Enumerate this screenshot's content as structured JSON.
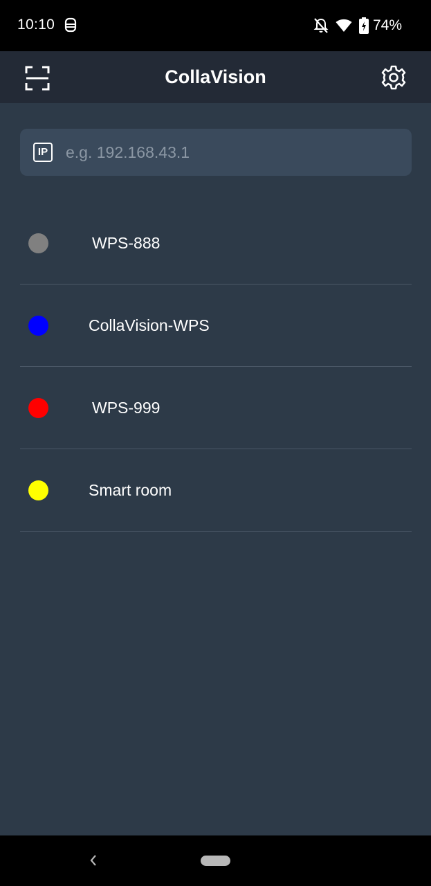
{
  "status_bar": {
    "time": "10:10",
    "battery": "74%",
    "icons": [
      "notification-icon",
      "bell-off-icon",
      "wifi-icon",
      "battery-charging-icon"
    ]
  },
  "app_bar": {
    "title": "CollaVision",
    "left_icon": "scan-icon",
    "right_icon": "gear-icon"
  },
  "ip_field": {
    "icon_label": "IP",
    "placeholder": "e.g. 192.168.43.1",
    "value": ""
  },
  "devices": [
    {
      "name": "WPS-888",
      "status_color": "#808080"
    },
    {
      "name": "CollaVision-WPS",
      "status_color": "#0000ff"
    },
    {
      "name": "WPS-999",
      "status_color": "#ff0000"
    },
    {
      "name": "Smart room",
      "status_color": "#ffff00"
    }
  ],
  "nav_bar": {
    "icons": [
      "back-icon",
      "home-pill"
    ]
  },
  "colors": {
    "app_bar": "#232a36",
    "background": "#2d3a48",
    "input": "#3a4a5c"
  }
}
